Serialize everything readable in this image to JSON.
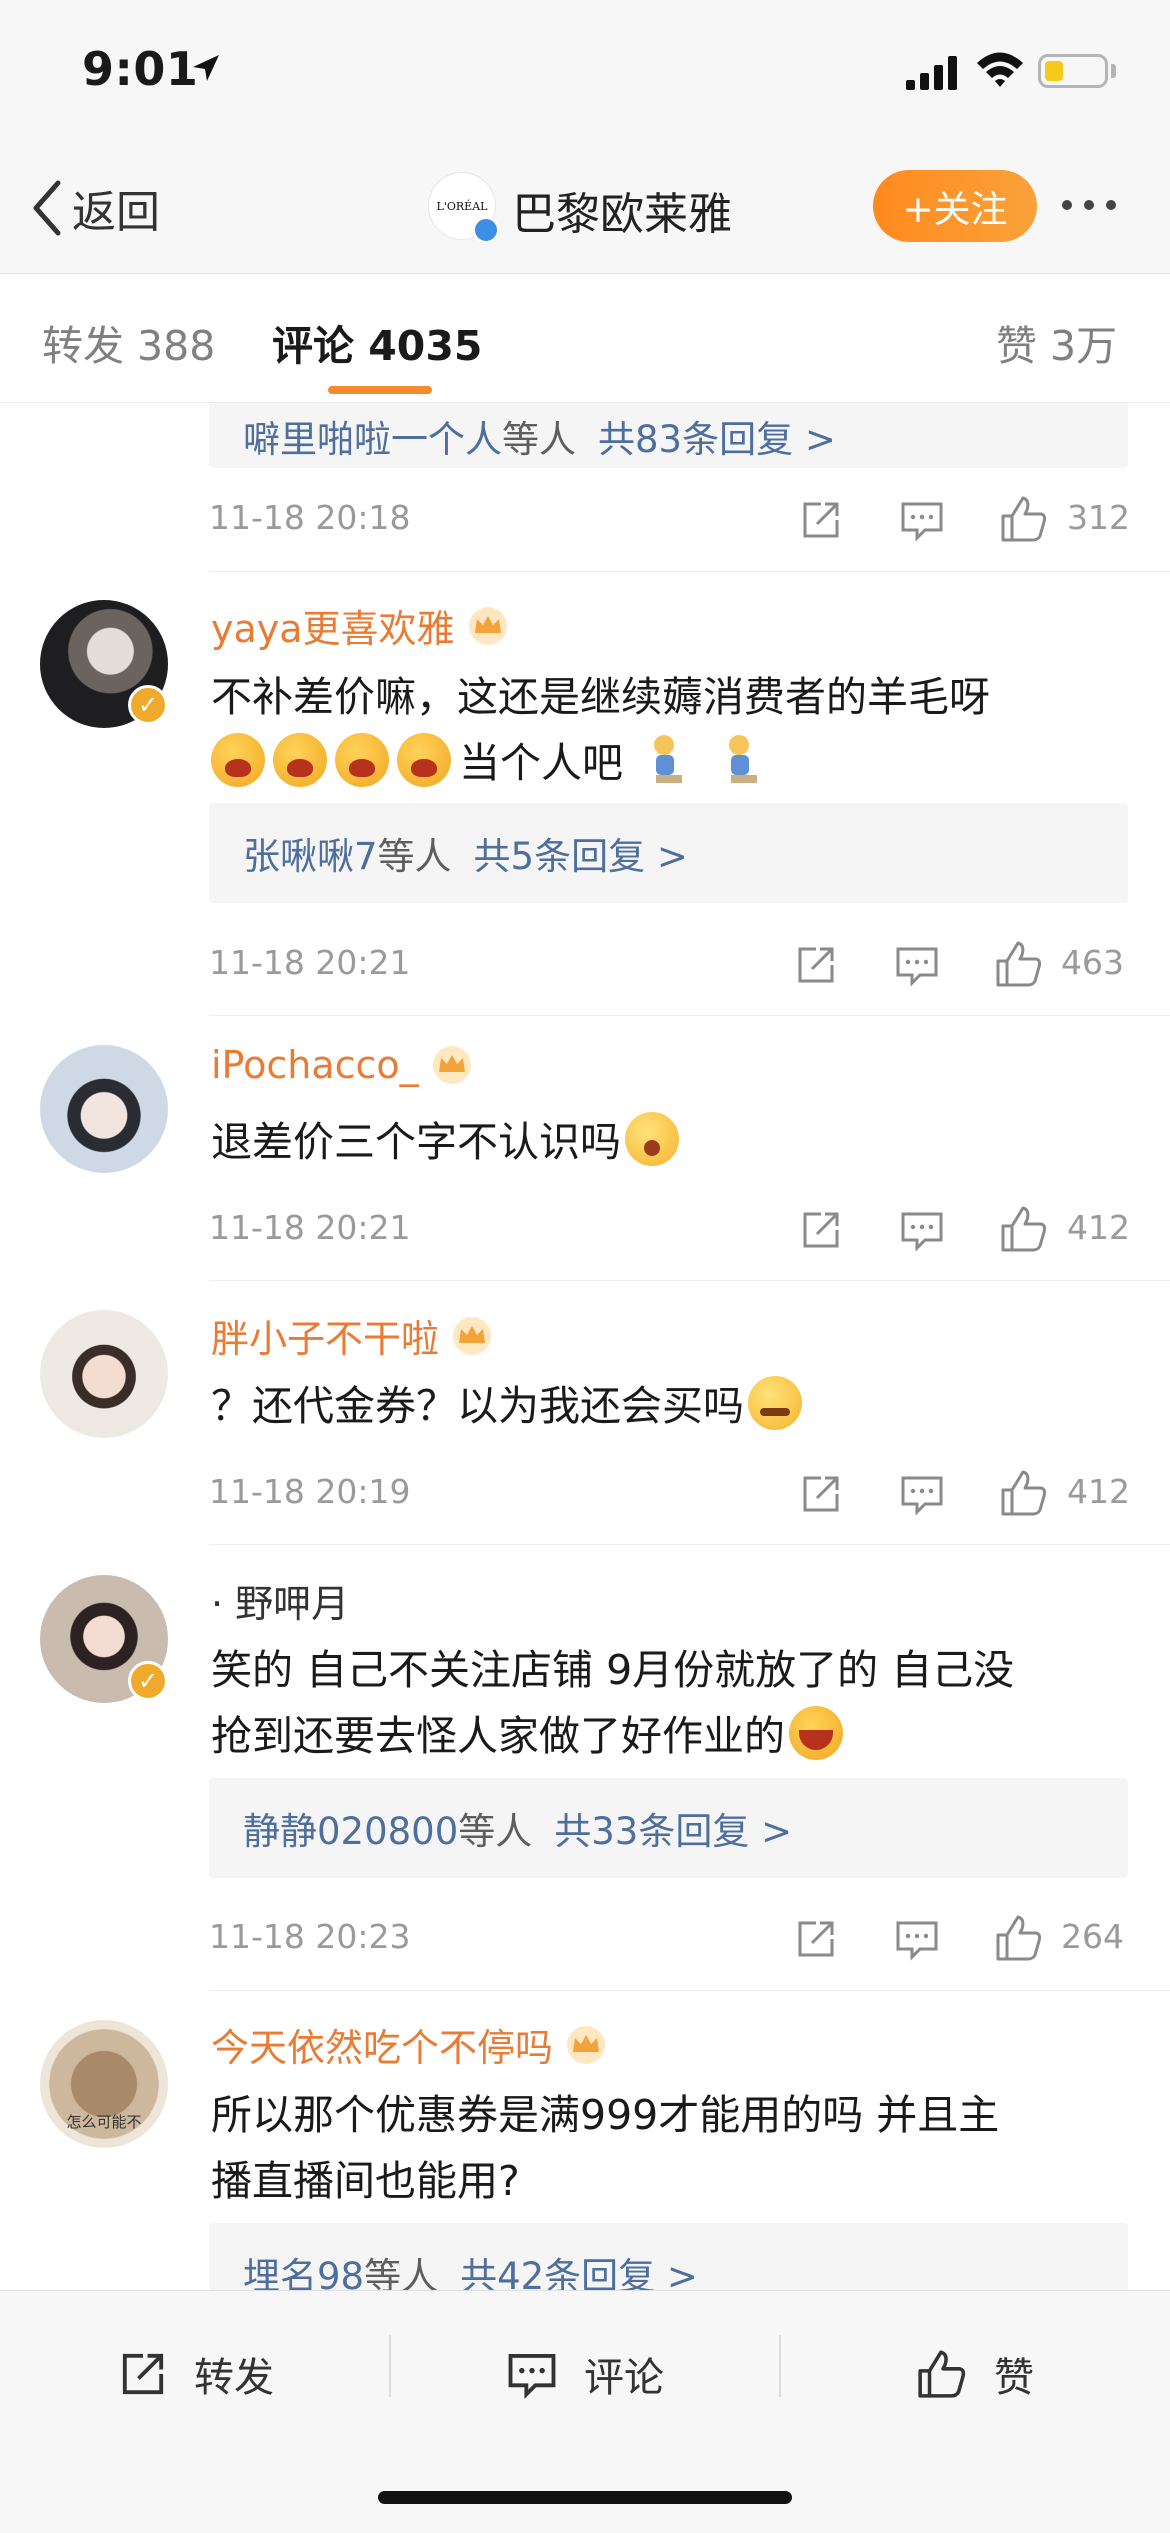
{
  "status_bar": {
    "time": "9:01"
  },
  "nav": {
    "back_label": "返回",
    "brand_name": "巴黎欧莱雅",
    "logo_text": "L'ORÉAL",
    "follow_label": "+关注"
  },
  "tabs": {
    "repost": "转发 388",
    "comments": "评论 4035",
    "likes": "赞 3万"
  },
  "comments": [
    {
      "partial": true,
      "reply_preview": {
        "names": "噼里啪啦一个人",
        "mid": "等人",
        "count": "共83条回复 >"
      },
      "date": "11-18 20:18",
      "likes": "312"
    },
    {
      "user": "yaya更喜欢雅",
      "text_line1": "不补差价嘛，这还是继续薅消费者的羊毛呀",
      "text_line2": "当个人吧",
      "reply_preview": {
        "names": "张啾啾7",
        "mid": "等人",
        "count": "共5条回复 >"
      },
      "date": "11-18 20:21",
      "likes": "463"
    },
    {
      "user": "iPochacco_",
      "text": "退差价三个字不认识吗",
      "date": "11-18 20:21",
      "likes": "412"
    },
    {
      "user": "胖小子不干啦",
      "text": "？还代金券？以为我还会买吗",
      "date": "11-18 20:19",
      "likes": "412"
    },
    {
      "user": "· 野呷月",
      "text_line1": "笑的 自己不关注店铺 9月份就放了的 自己没",
      "text_line2": "抢到还要去怪人家做了好作业的",
      "reply_preview": {
        "names": "静静020800",
        "mid": "等人",
        "count": "共33条回复 >"
      },
      "date": "11-18 20:23",
      "likes": "264"
    },
    {
      "user": "今天依然吃个不停吗",
      "text_line1": "所以那个优惠券是满999才能用的吗 并且主",
      "text_line2": "播直播间也能用?",
      "reply_preview": {
        "names": "埋名98",
        "mid": "等人",
        "count": "共42条回复 >"
      }
    }
  ],
  "avatar_text": "怎么可能不",
  "bottom_bar": {
    "repost": "转发",
    "comment": "评论",
    "like": "赞"
  },
  "colors": {
    "accent_orange": "#ea7b35",
    "follow_bg": "#f99a2c",
    "link_blue": "#4e6f9d",
    "tab_underline": "#f48b2f"
  }
}
